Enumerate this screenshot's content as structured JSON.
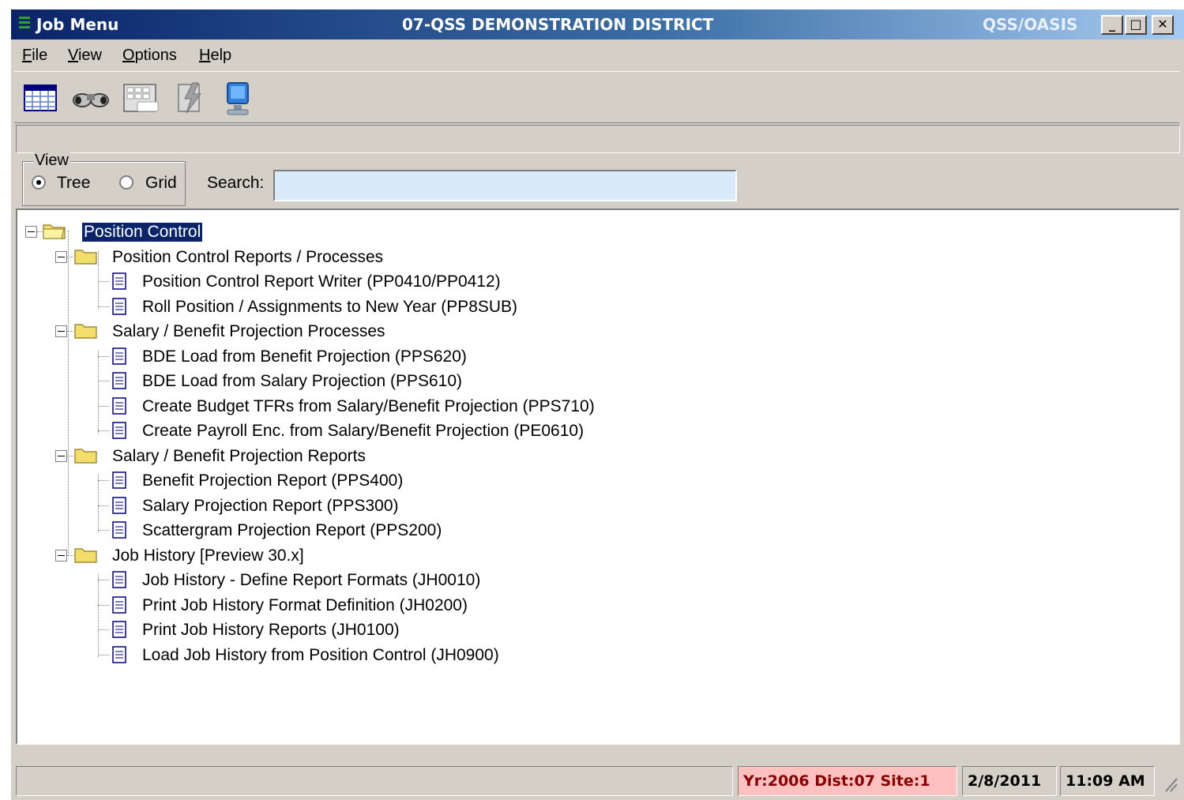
{
  "window": {
    "title": "Job Menu",
    "district": "07-QSS DEMONSTRATION DISTRICT",
    "system": "QSS/OASIS",
    "buttons": {
      "minimize": "_",
      "maximize": "□",
      "close": "✕"
    }
  },
  "menu": [
    {
      "key": "F",
      "rest": "ile"
    },
    {
      "key": "V",
      "rest": "iew"
    },
    {
      "key": "O",
      "rest": "ptions"
    },
    {
      "key": "H",
      "rest": "elp"
    }
  ],
  "toolbar": {
    "icons": [
      "grid-icon",
      "binoculars-icon",
      "keyboard-icon",
      "lightning-doc-icon",
      "monitor-icon"
    ]
  },
  "view_group": {
    "legend": "View",
    "options": [
      {
        "label": "Tree",
        "checked": true
      },
      {
        "label": "Grid",
        "checked": false
      }
    ]
  },
  "search": {
    "label": "Search:",
    "value": ""
  },
  "tree": {
    "root": "Position Control",
    "groups": [
      {
        "label": "Position Control Reports / Processes",
        "items": [
          "Position Control Report Writer (PP0410/PP0412)",
          "Roll Position / Assignments to New Year (PP8SUB)"
        ]
      },
      {
        "label": "Salary / Benefit Projection Processes",
        "items": [
          "BDE Load from Benefit Projection (PPS620)",
          "BDE Load from Salary Projection (PPS610)",
          "Create Budget TFRs from Salary/Benefit Projection (PPS710)",
          "Create Payroll Enc. from Salary/Benefit Projection (PE0610)"
        ]
      },
      {
        "label": "Salary / Benefit Projection Reports",
        "items": [
          "Benefit Projection Report (PPS400)",
          "Salary Projection Report (PPS300)",
          "Scattergram Projection Report (PPS200)"
        ]
      },
      {
        "label": "Job History [Preview 30.x]",
        "items": [
          "Job History - Define Report Formats (JH0010)",
          "Print Job History Format Definition (JH0200)",
          "Print Job History Reports (JH0100)",
          "Load Job History from Position Control (JH0900)"
        ]
      }
    ]
  },
  "status": {
    "context": "Yr:2006  Dist:07  Site:1",
    "date": "2/8/2011",
    "time": "11:09 AM"
  }
}
